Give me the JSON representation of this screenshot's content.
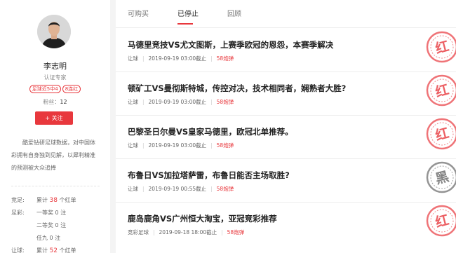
{
  "profile": {
    "name": "李志明",
    "role": "认证专家",
    "badges": [
      "足球近5中4",
      "8连红"
    ],
    "fans_label": "粉丝：",
    "fans_count": "12",
    "follow_label": "+ 关注",
    "bio": "酷爱钻研足球数据，对中国体彩拥有自身独到见解，以犀利精准的预测被大众追捧"
  },
  "stats": [
    {
      "label": "竞足:",
      "prefix": "累计 ",
      "value": "38",
      "suffix": " 个红单"
    },
    {
      "label": "足彩:",
      "prefix": "一等奖 ",
      "value": "",
      "suffix": "0 注"
    },
    {
      "label": "",
      "prefix": "二等奖 ",
      "value": "",
      "suffix": "0 注"
    },
    {
      "label": "",
      "prefix": "任九 ",
      "value": "",
      "suffix": "0 注"
    },
    {
      "label": "让球:",
      "prefix": "累计 ",
      "value": "52",
      "suffix": " 个红单"
    }
  ],
  "tabs": [
    "可购买",
    "已停止",
    "回顾"
  ],
  "active_tab": "已停止",
  "articles": [
    {
      "title": "马德里竞技VS尤文图斯，上赛季欧冠的恩怨，本赛季解决",
      "category": "让球",
      "time": "2019-09-19 03:00截止",
      "price": "58炮弹",
      "stamp": "红",
      "stamp_color": "#e8383d"
    },
    {
      "title": "顿矿工VS曼彻斯特城，传控对决，技术相同者，娴熟者大胜?",
      "category": "让球",
      "time": "2019-09-19 03:00截止",
      "price": "58炮弹",
      "stamp": "红",
      "stamp_color": "#e8383d"
    },
    {
      "title": "巴黎圣日尔曼VS皇家马德里，欧冠北单推荐。",
      "category": "让球",
      "time": "2019-09-19 03:00截止",
      "price": "58炮弹",
      "stamp": "红",
      "stamp_color": "#e8383d"
    },
    {
      "title": "布鲁日VS加拉塔萨雷，布鲁日能否主场取胜?",
      "category": "让球",
      "time": "2019-09-19 00:55截止",
      "price": "58炮弹",
      "stamp": "黑",
      "stamp_color": "#666666"
    },
    {
      "title": "鹿岛鹿角VS广州恒大淘宝，亚冠竞彩推荐",
      "category": "竞彩足球",
      "time": "2019-09-18 18:00截止",
      "price": "58炮弹",
      "stamp": "红",
      "stamp_color": "#e8383d"
    }
  ],
  "colors": {
    "accent": "#e8383d",
    "stamp_black": "#666666"
  }
}
